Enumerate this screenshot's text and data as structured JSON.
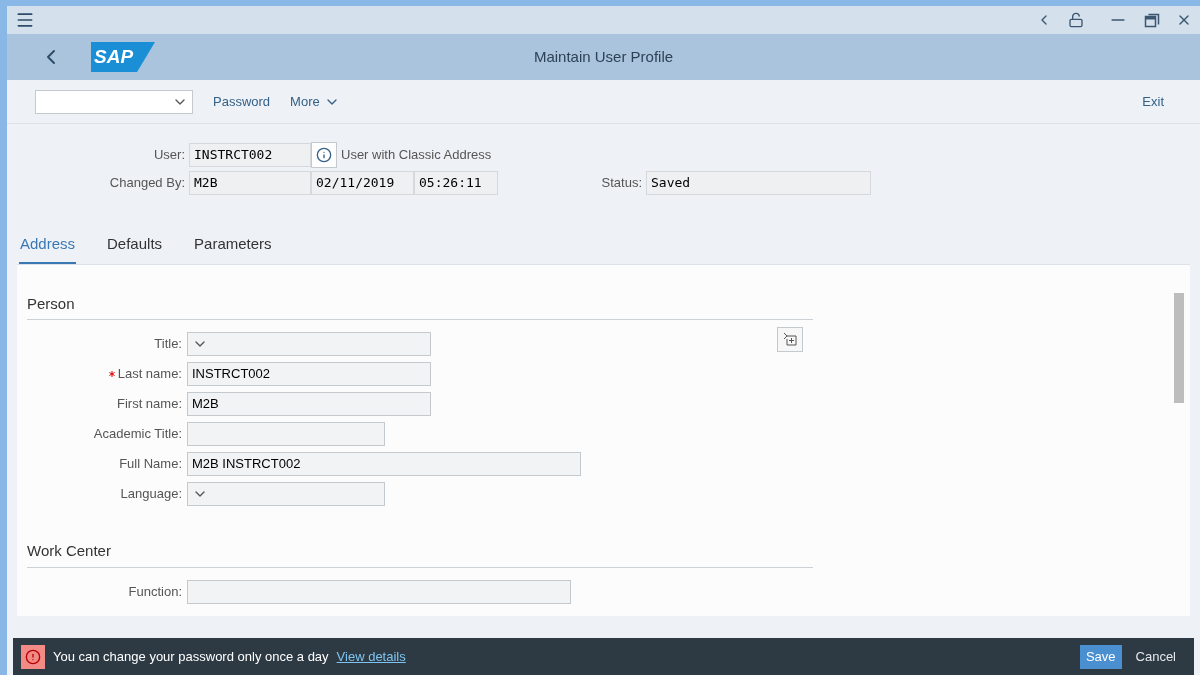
{
  "window": {
    "title": "Maintain User Profile",
    "logo": "SAP"
  },
  "toolbar": {
    "items": [
      "Password",
      "More"
    ],
    "exit": "Exit"
  },
  "header": {
    "user": {
      "label": "User:",
      "value": "INSTRCT002",
      "note": "User with Classic Address"
    },
    "changed_by": {
      "label": "Changed By:",
      "values": [
        "M2B",
        "02/11/2019",
        "05:26:11"
      ]
    },
    "status": {
      "label": "Status:",
      "value": "Saved"
    }
  },
  "tabs": [
    {
      "label": "Address",
      "selected": true
    },
    {
      "label": "Defaults",
      "selected": false
    },
    {
      "label": "Parameters",
      "selected": false
    }
  ],
  "sections": [
    {
      "title": "Person",
      "fields": [
        {
          "label": "Title:",
          "kind": "dropdown",
          "required": false
        },
        {
          "label": "Last name:",
          "kind": "text",
          "value": "INSTRCT002",
          "required": true
        },
        {
          "label": "First name:",
          "kind": "text",
          "value": "M2B",
          "required": false
        },
        {
          "label": "Academic Title:",
          "kind": "text",
          "required": false
        },
        {
          "label": "Full Name:",
          "kind": "text",
          "value": "M2B INSTRCT002",
          "required": false
        },
        {
          "label": "Language:",
          "kind": "dropdown",
          "required": false
        }
      ]
    },
    {
      "title": "Work Center",
      "fields": [
        {
          "label": "Function:",
          "kind": "text",
          "required": false
        }
      ]
    }
  ],
  "message": {
    "text": "You can change your password only once a day",
    "link": "View details"
  },
  "footer_buttons": [
    "Save",
    "Cancel"
  ]
}
